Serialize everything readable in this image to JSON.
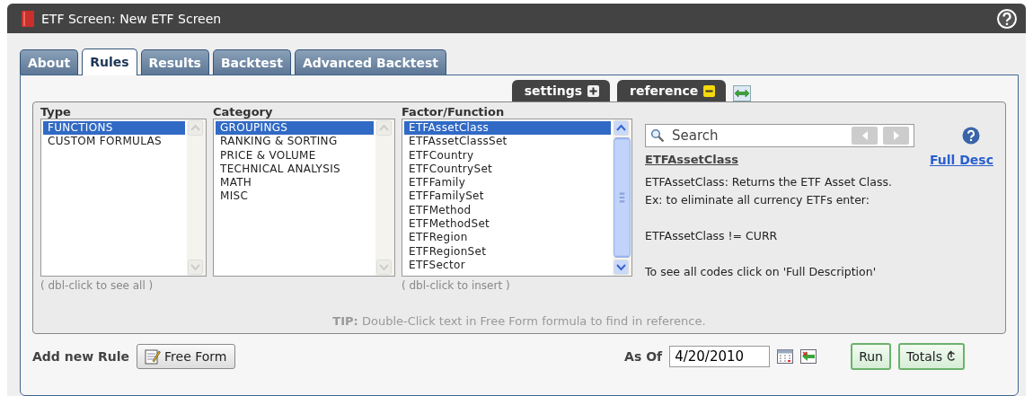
{
  "window": {
    "title": "ETF Screen: New ETF Screen"
  },
  "tabs": [
    {
      "label": "About",
      "selected": false
    },
    {
      "label": "Rules",
      "selected": true
    },
    {
      "label": "Results",
      "selected": false
    },
    {
      "label": "Backtest",
      "selected": false
    },
    {
      "label": "Advanced Backtest",
      "selected": false
    }
  ],
  "panel_tabs": [
    {
      "label": "settings",
      "expanded": false
    },
    {
      "label": "reference",
      "expanded": true
    }
  ],
  "lists": [
    {
      "title": "Type",
      "scrollable": false,
      "hint": "( dbl-click to see all )",
      "items": [
        {
          "label": "FUNCTIONS",
          "selected": true
        },
        {
          "label": "CUSTOM FORMULAS",
          "selected": false
        }
      ]
    },
    {
      "title": "Category",
      "scrollable": false,
      "items": [
        {
          "label": "GROUPINGS",
          "selected": true
        },
        {
          "label": "RANKING & SORTING",
          "selected": false
        },
        {
          "label": "PRICE & VOLUME",
          "selected": false
        },
        {
          "label": "TECHNICAL ANALYSIS",
          "selected": false
        },
        {
          "label": "MATH",
          "selected": false
        },
        {
          "label": "MISC",
          "selected": false
        }
      ]
    },
    {
      "title": "Factor/Function",
      "scrollable": true,
      "hint": "( dbl-click to insert )",
      "items": [
        {
          "label": "ETFAssetClass",
          "selected": true
        },
        {
          "label": "ETFAssetClassSet",
          "selected": false
        },
        {
          "label": "ETFCountry",
          "selected": false
        },
        {
          "label": "ETFCountrySet",
          "selected": false
        },
        {
          "label": "ETFFamily",
          "selected": false
        },
        {
          "label": "ETFFamilySet",
          "selected": false
        },
        {
          "label": "ETFMethod",
          "selected": false
        },
        {
          "label": "ETFMethodSet",
          "selected": false
        },
        {
          "label": "ETFRegion",
          "selected": false
        },
        {
          "label": "ETFRegionSet",
          "selected": false
        },
        {
          "label": "ETFSector",
          "selected": false
        }
      ]
    }
  ],
  "reference": {
    "search": {
      "placeholder": "Search"
    },
    "function_name": "ETFAssetClass",
    "link": "Full Desc",
    "paragraphs": [
      [
        "ETFAssetClass: Returns the ETF Asset Class.",
        "Ex: to eliminate all currency ETFs enter:"
      ],
      [
        "ETFAssetClass != CURR"
      ],
      [
        "To see all codes click on 'Full Description'"
      ]
    ]
  },
  "tip": "**TIP:** Double-Click text in Free Form formula to find in reference.",
  "footer": {
    "add_rule_label": "Add new Rule",
    "free_form_button": "Free Form",
    "as_of_label": "As Of",
    "date": "4/20/2010",
    "run_button": "Run",
    "totals_button": "Totals"
  }
}
